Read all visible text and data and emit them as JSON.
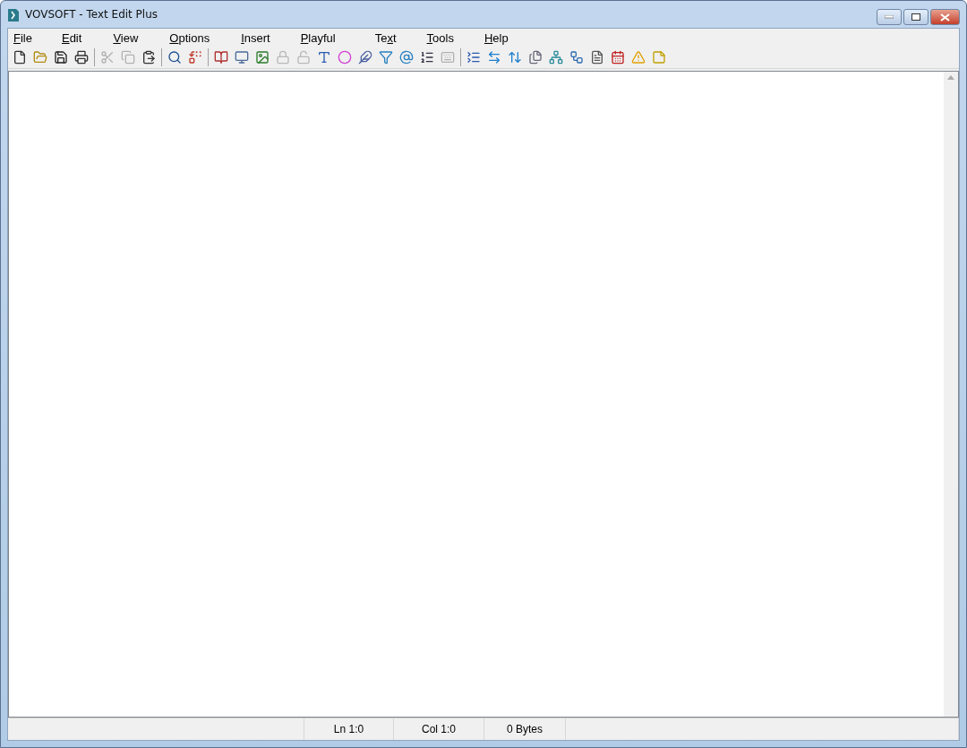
{
  "window": {
    "title": "VOVSOFT - Text Edit Plus"
  },
  "menu": [
    {
      "parts": [
        {
          "text": "F",
          "underlined": true
        },
        {
          "text": "ile",
          "underlined": false
        }
      ]
    },
    {
      "parts": [
        {
          "text": "E",
          "underlined": true
        },
        {
          "text": "dit",
          "underlined": false
        }
      ]
    },
    {
      "parts": [
        {
          "text": "V",
          "underlined": true
        },
        {
          "text": "iew",
          "underlined": false
        }
      ]
    },
    {
      "parts": [
        {
          "text": "O",
          "underlined": true
        },
        {
          "text": "ptions",
          "underlined": false
        }
      ]
    },
    {
      "parts": [
        {
          "text": "I",
          "underlined": true
        },
        {
          "text": "nsert",
          "underlined": false
        }
      ]
    },
    {
      "parts": [
        {
          "text": "P",
          "underlined": true
        },
        {
          "text": "layful",
          "underlined": false
        }
      ]
    },
    {
      "parts": [
        {
          "text": "Te",
          "underlined": false
        },
        {
          "text": "x",
          "underlined": true
        },
        {
          "text": "t",
          "underlined": false
        }
      ]
    },
    {
      "parts": [
        {
          "text": "T",
          "underlined": true
        },
        {
          "text": "ools",
          "underlined": false
        }
      ]
    },
    {
      "parts": [
        {
          "text": "H",
          "underlined": true
        },
        {
          "text": "elp",
          "underlined": false
        }
      ]
    }
  ],
  "toolbar": [
    {
      "kind": "button",
      "disabled": false
    },
    {
      "kind": "button",
      "disabled": false
    },
    {
      "kind": "button",
      "disabled": false
    },
    {
      "kind": "button",
      "disabled": false
    },
    {
      "kind": "separator"
    },
    {
      "kind": "button",
      "disabled": true
    },
    {
      "kind": "button",
      "disabled": true
    },
    {
      "kind": "button",
      "disabled": false
    },
    {
      "kind": "separator"
    },
    {
      "kind": "button",
      "disabled": false
    },
    {
      "kind": "button",
      "disabled": false
    },
    {
      "kind": "separator"
    },
    {
      "kind": "button",
      "disabled": false
    },
    {
      "kind": "button",
      "disabled": false
    },
    {
      "kind": "button",
      "disabled": false
    },
    {
      "kind": "button",
      "disabled": true
    },
    {
      "kind": "button",
      "disabled": true
    },
    {
      "kind": "button",
      "disabled": false
    },
    {
      "kind": "button",
      "disabled": false
    },
    {
      "kind": "button",
      "disabled": false
    },
    {
      "kind": "button",
      "disabled": false
    },
    {
      "kind": "button",
      "disabled": false
    },
    {
      "kind": "button",
      "disabled": false
    },
    {
      "kind": "button",
      "disabled": true
    },
    {
      "kind": "separator"
    },
    {
      "kind": "button",
      "disabled": false
    },
    {
      "kind": "button",
      "disabled": false
    },
    {
      "kind": "button",
      "disabled": false
    },
    {
      "kind": "button",
      "disabled": false
    },
    {
      "kind": "button",
      "disabled": false
    },
    {
      "kind": "button",
      "disabled": false
    },
    {
      "kind": "button",
      "disabled": false
    },
    {
      "kind": "button",
      "disabled": false
    },
    {
      "kind": "button",
      "disabled": false
    },
    {
      "kind": "button",
      "disabled": false
    }
  ],
  "status_bar": [
    "Ln 1:0",
    "Col 1:0",
    "0 Bytes"
  ]
}
